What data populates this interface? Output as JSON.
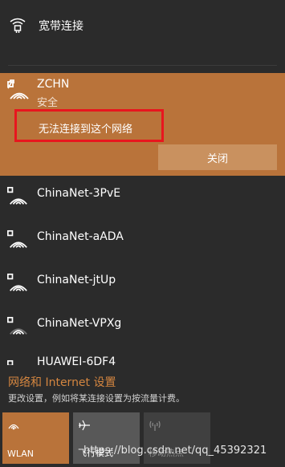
{
  "broadband": {
    "label": "宽带连接",
    "icon": "ethernet-dialup-icon"
  },
  "active_network": {
    "ssid": "ZCHN",
    "security": "安全",
    "error_message": "无法连接到这个网络",
    "close_label": "关闭",
    "accent_color": "#b9733a",
    "highlight_color": "#e8161e"
  },
  "networks": [
    {
      "ssid": "ChinaNet-3PvE",
      "icon": "wifi-secured-icon"
    },
    {
      "ssid": "ChinaNet-aADA",
      "icon": "wifi-secured-icon"
    },
    {
      "ssid": "ChinaNet-jtUp",
      "icon": "wifi-secured-icon"
    },
    {
      "ssid": "ChinaNet-VPXg",
      "icon": "wifi-secured-icon"
    },
    {
      "ssid": "HUAWEI-6DF4",
      "icon": "wifi-secured-icon"
    }
  ],
  "settings": {
    "title": "网络和 Internet 设置",
    "description": "更改设置，例如将某连接设置为按流量计费。"
  },
  "quick_actions": [
    {
      "label": "WLAN",
      "icon": "wifi-icon",
      "state": "on"
    },
    {
      "label": "飞行模式",
      "icon": "airplane-icon",
      "state": "off"
    },
    {
      "label": "移动热点",
      "icon": "hotspot-icon",
      "state": "disabled"
    }
  ],
  "watermark": "https://blog.csdn.net/qq_45392321"
}
